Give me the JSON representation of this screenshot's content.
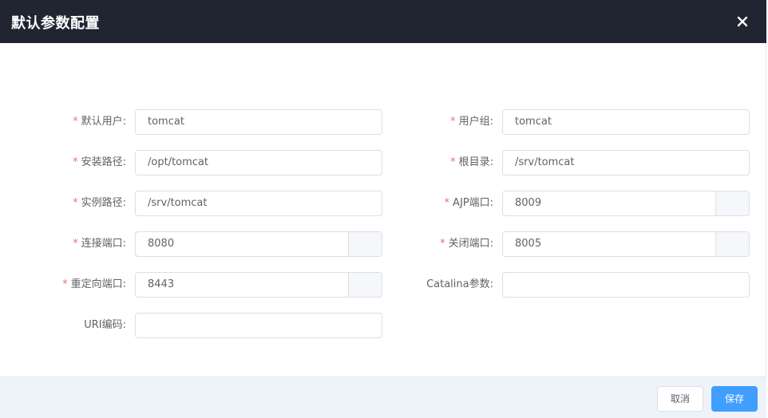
{
  "dialog": {
    "title": "默认参数配置",
    "close_icon": "close-icon"
  },
  "form": {
    "default_user": {
      "label": "默认用户:",
      "required": "*",
      "value": "tomcat"
    },
    "user_group": {
      "label": "用户组:",
      "required": "*",
      "value": "tomcat"
    },
    "install_path": {
      "label": "安装路径:",
      "required": "*",
      "value": "/opt/tomcat"
    },
    "root_dir": {
      "label": "根目录:",
      "required": "*",
      "value": "/srv/tomcat"
    },
    "instance_path": {
      "label": "实例路径:",
      "required": "*",
      "value": "/srv/tomcat"
    },
    "ajp_port": {
      "label": "AJP端口:",
      "required": "*",
      "value": "8009"
    },
    "connect_port": {
      "label": "连接端口:",
      "required": "*",
      "value": "8080"
    },
    "shutdown_port": {
      "label": "关闭端口:",
      "required": "*",
      "value": "8005"
    },
    "redirect_port": {
      "label": "重定向端口:",
      "required": "*",
      "value": "8443"
    },
    "catalina_params": {
      "label": "Catalina参数:",
      "value": ""
    },
    "uri_encoding": {
      "label": "URI编码:",
      "value": ""
    }
  },
  "footer": {
    "cancel_label": "取消",
    "save_label": "保存"
  },
  "colors": {
    "header_bg": "#212532",
    "primary": "#409eff",
    "required": "#f56c6c",
    "footer_bg": "#eef2f9"
  }
}
